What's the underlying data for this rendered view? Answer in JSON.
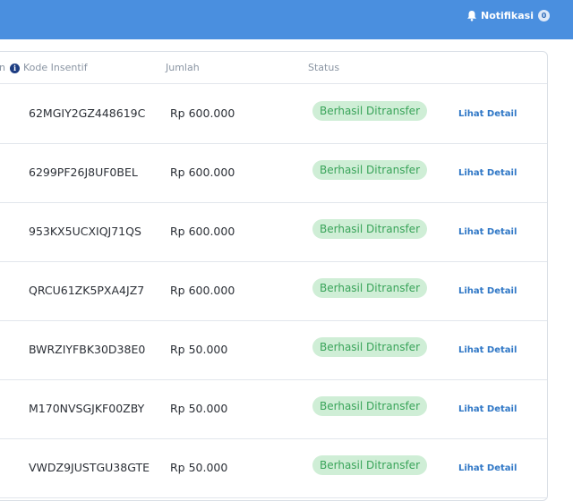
{
  "header": {
    "notif_label": "Notifikasi",
    "notif_count": "0"
  },
  "table": {
    "col_truncated": "n",
    "col_kode": "Kode Insentif",
    "col_jumlah": "Jumlah",
    "col_status": "Status",
    "rows": [
      {
        "kode": "62MGIY2GZ448619C",
        "jumlah": "Rp 600.000",
        "status": "Berhasil Ditransfer",
        "action": "Lihat Detail"
      },
      {
        "kode": "6299PF26J8UF0BEL",
        "jumlah": "Rp 600.000",
        "status": "Berhasil Ditransfer",
        "action": "Lihat Detail"
      },
      {
        "kode": "953KX5UCXIQJ71QS",
        "jumlah": "Rp 600.000",
        "status": "Berhasil Ditransfer",
        "action": "Lihat Detail"
      },
      {
        "kode": "QRCU61ZK5PXA4JZ7",
        "jumlah": "Rp 600.000",
        "status": "Berhasil Ditransfer",
        "action": "Lihat Detail"
      },
      {
        "kode": "BWRZIYFBK30D38E0",
        "jumlah": "Rp 50.000",
        "status": "Berhasil Ditransfer",
        "action": "Lihat Detail"
      },
      {
        "kode": "M170NVSGJKF00ZBY",
        "jumlah": "Rp 50.000",
        "status": "Berhasil Ditransfer",
        "action": "Lihat Detail"
      },
      {
        "kode": "VWDZ9JUSTGU38GTE",
        "jumlah": "Rp 50.000",
        "status": "Berhasil Ditransfer",
        "action": "Lihat Detail"
      }
    ]
  },
  "colors": {
    "topbar": "#4a8fdf",
    "status_bg": "#cfeed6",
    "status_text": "#3aa45a",
    "link": "#2f77c6"
  },
  "icons": {
    "notification": "bell-icon",
    "info": "info-icon"
  }
}
